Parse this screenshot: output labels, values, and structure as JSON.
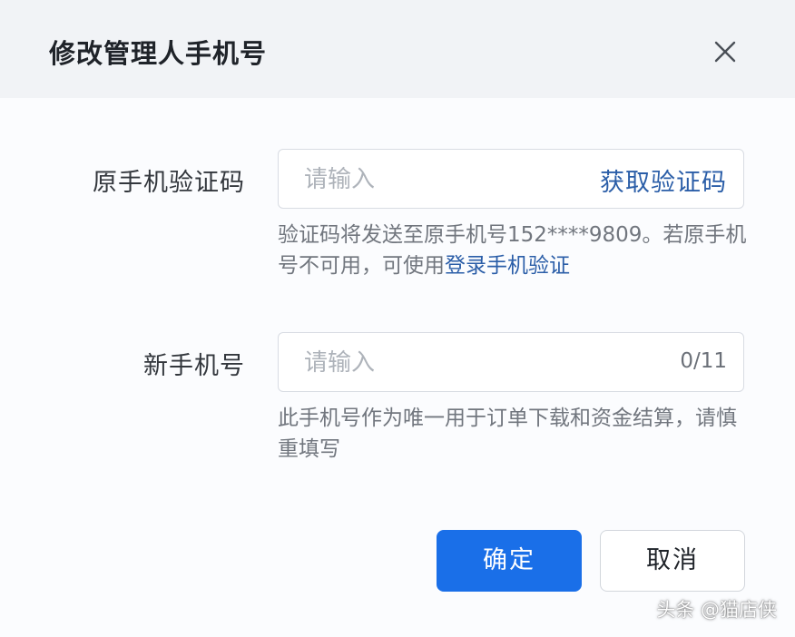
{
  "dialog": {
    "title": "修改管理人手机号",
    "close_icon": "close-icon"
  },
  "original_phone": {
    "label": "原手机验证码",
    "placeholder": "请输入",
    "value": "",
    "get_code_label": "获取验证码",
    "hint_text": "验证码将发送至原手机号152****9809。若原手机号不可用，可使用",
    "hint_link": "登录手机验证"
  },
  "new_phone": {
    "label": "新手机号",
    "placeholder": "请输入",
    "value": "",
    "counter": "0/11",
    "hint_text": "此手机号作为唯一用于订单下载和资金结算，请慎重填写"
  },
  "buttons": {
    "confirm_label": "确定",
    "cancel_label": "取消"
  },
  "watermark": "头条 @猫店侠",
  "colors": {
    "primary": "#1a6fe8",
    "link": "#2b5ea8",
    "header_bg": "#f1f3f6"
  }
}
